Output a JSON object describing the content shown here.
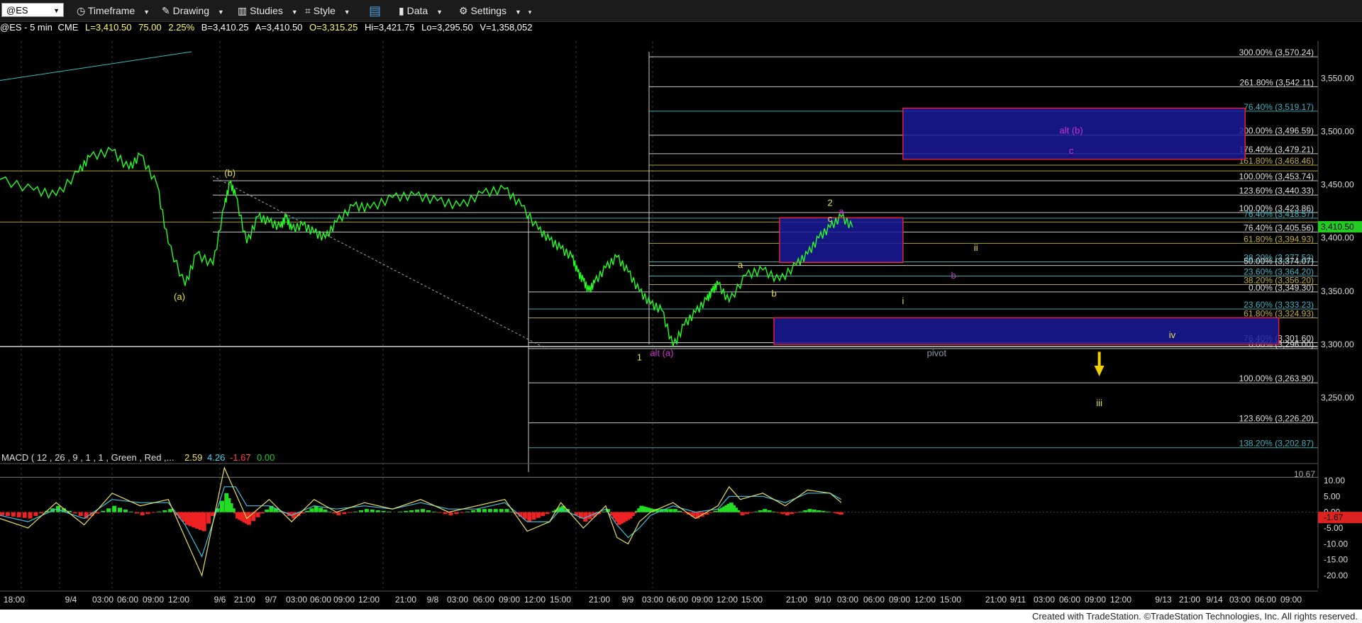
{
  "toolbar": {
    "symbol": "@ES",
    "timeframe": "Timeframe",
    "drawing": "Drawing",
    "studies": "Studies",
    "style": "Style",
    "data": "Data",
    "settings": "Settings"
  },
  "infobar": {
    "symbol": "@ES - 5 min",
    "exchange": "CME",
    "last": "L=3,410.50",
    "change": "75.00",
    "pct": "2.25%",
    "bid": "B=3,410.25",
    "ask": "A=3,410.50",
    "open": "O=3,315.25",
    "high": "Hi=3,421.75",
    "low": "Lo=3,295.50",
    "volume": "V=1,358,052"
  },
  "colors": {
    "price_line": "#22ff22",
    "wave_yellow": "#e8e04a",
    "wave_purple": "#cc33cc",
    "box_fill": "#1a1a9a",
    "box_border": "#e0203a",
    "macd_line": "#e8e060",
    "signal_line": "#40c0e0",
    "hist_up": "#22dd22",
    "hist_down": "#ee2222"
  },
  "chart_data": [
    {
      "type": "line",
      "title": "",
      "ylim": [
        3200,
        3585
      ],
      "y_ticks": [
        "3,550.00",
        "3,500.00",
        "3,450.00",
        "3,400.00",
        "3,350.00",
        "3,300.00",
        "3,250.00"
      ],
      "y_tick_values": [
        3550,
        3500,
        3450,
        3400,
        3350,
        3300,
        3250
      ],
      "x_ticks": [
        "18:00",
        "9/4",
        "03:00",
        "06:00",
        "09:00",
        "12:00",
        "9/6",
        "21:00",
        "9/7",
        "03:00",
        "06:00",
        "09:00",
        "12:00",
        "21:00",
        "9/8",
        "03:00",
        "06:00",
        "09:00",
        "12:00",
        "15:00",
        "21:00",
        "9/9",
        "03:00",
        "06:00",
        "09:00",
        "12:00",
        "15:00",
        "21:00",
        "9/10",
        "03:00",
        "06:00",
        "09:00",
        "12:00",
        "15:00",
        "21:00",
        "9/11",
        "03:00",
        "06:00",
        "09:00",
        "12:00",
        "9/13",
        "21:00",
        "9/14",
        "03:00",
        "06:00",
        "09:00"
      ],
      "current_price_label": "3,410.50",
      "series": [
        {
          "x": [
            0,
            6,
            10,
            14,
            16,
            20,
            23,
            25,
            28,
            30,
            33,
            35,
            38,
            40,
            41,
            42,
            44,
            46,
            48,
            50,
            51,
            52,
            54,
            56,
            58,
            60,
            63,
            66,
            70,
            74,
            78,
            82,
            86,
            90,
            93,
            96,
            98,
            100,
            102,
            103,
            104,
            105,
            106,
            108,
            110,
            112,
            114,
            116,
            118,
            120,
            122,
            124,
            126,
            127,
            128,
            130,
            133,
            136,
            139,
            142,
            144,
            146,
            148,
            150,
            152
          ],
          "values": [
            3455,
            3445,
            3440,
            3462,
            3476,
            3482,
            3465,
            3478,
            3450,
            3395,
            3355,
            3385,
            3375,
            3430,
            3452,
            3440,
            3395,
            3420,
            3415,
            3410,
            3420,
            3408,
            3412,
            3405,
            3400,
            3415,
            3430,
            3428,
            3438,
            3440,
            3435,
            3430,
            3442,
            3446,
            3430,
            3408,
            3398,
            3390,
            3382,
            3368,
            3360,
            3350,
            3358,
            3372,
            3382,
            3368,
            3350,
            3338,
            3332,
            3298,
            3318,
            3330,
            3342,
            3350,
            3357,
            3340,
            3365,
            3370,
            3360,
            3375,
            3385,
            3400,
            3410,
            3420,
            3410
          ]
        }
      ],
      "wave_labels": [
        {
          "text": "(b)",
          "color": "yellow",
          "x": 41,
          "y": 3458
        },
        {
          "text": "(a)",
          "color": "yellow",
          "x": 32,
          "y": 3342
        },
        {
          "text": "1",
          "color": "yellow",
          "x": 114,
          "y": 3285
        },
        {
          "text": "alt (a)",
          "color": "purple",
          "x": 118,
          "y": 3289
        },
        {
          "text": "a",
          "color": "yellow",
          "x": 132,
          "y": 3372
        },
        {
          "text": "b",
          "color": "yellow",
          "x": 138,
          "y": 3345
        },
        {
          "text": "2",
          "color": "yellow",
          "x": 148,
          "y": 3430
        },
        {
          "text": "c",
          "color": "yellow",
          "x": 148,
          "y": 3415
        },
        {
          "text": "a",
          "color": "purple",
          "x": 150,
          "y": 3422
        },
        {
          "text": "ii",
          "color": "yellow",
          "x": 174,
          "y": 3388
        },
        {
          "text": "b",
          "color": "purple",
          "x": 170,
          "y": 3362
        },
        {
          "text": "i",
          "color": "yellow",
          "x": 161,
          "y": 3338
        },
        {
          "text": "iv",
          "color": "yellow",
          "x": 209,
          "y": 3306
        },
        {
          "text": "alt (b)",
          "color": "purple",
          "x": 191,
          "y": 3498
        },
        {
          "text": "c",
          "color": "purple",
          "x": 191,
          "y": 3479
        },
        {
          "text": "pivot",
          "color": "gray",
          "x": 167,
          "y": 3289
        },
        {
          "text": "iii",
          "color": "yellow",
          "x": 196,
          "y": 3242
        }
      ],
      "fib_levels": [
        "300.00% (3,570.24)",
        "261.80% (3,542.11)",
        "76.40% (3,519.17)",
        "200.00% (3,496.59)",
        "176.40% (3,479.21)",
        "161.80% (3,468.46)",
        "100.00% (3,453.74)",
        "123.60% (3,440.33)",
        "100.00% (3,423.86)",
        "76.40% (3,418.57)",
        "76.40% (3,405.56)",
        "61.80% (3,394.93)",
        "38.20% (3,377.53)",
        "50.00% (3,374.07)",
        "23.60% (3,364.20)",
        "38.20% (3,356.20)",
        "0.00% (3,349.30)",
        "23.60% (3,333.23)",
        "61.80% (3,324.93)",
        "76.40% (3,301.60)",
        "0.00% (3,296.00)",
        "100.00% (3,263.90)",
        "123.60% (3,226.20)",
        "138.20% (3,202.87)"
      ],
      "fib_level_values": [
        3570.24,
        3542.11,
        3519.17,
        3496.59,
        3479.21,
        3468.46,
        3453.74,
        3440.33,
        3423.86,
        3418.57,
        3405.56,
        3394.93,
        3377.53,
        3374.07,
        3364.2,
        3356.2,
        3349.3,
        3333.23,
        3324.93,
        3301.6,
        3296.0,
        3263.9,
        3226.2,
        3202.87
      ],
      "fib_level_colors": [
        "white",
        "white",
        "teal",
        "white",
        "white",
        "olive",
        "white",
        "white",
        "white",
        "teal",
        "white",
        "olive",
        "teal",
        "white",
        "teal",
        "olive",
        "white",
        "teal",
        "olive",
        "white",
        "white",
        "white",
        "white",
        "teal"
      ],
      "target_boxes": [
        {
          "name": "alt (b)",
          "x0": 161,
          "x1": 222,
          "y0": 3474,
          "y1": 3522
        },
        {
          "name": "c wave box",
          "x0": 139,
          "x1": 161,
          "y0": 3377,
          "y1": 3419
        },
        {
          "name": "iv box",
          "x0": 138,
          "x1": 228,
          "y0": 3300,
          "y1": 3325
        }
      ]
    },
    {
      "type": "line",
      "title": "MACD ( 12 , 26 , 9 , 1 , 1 , Green , Red ,...",
      "values_legend": [
        "2.59",
        "4.26",
        "-1.67",
        "0.00"
      ],
      "ylim": [
        -24,
        14
      ],
      "y_ticks": [
        "10.00",
        "5.00",
        "0.00",
        "-5.00",
        "-10.00",
        "-15.00",
        "-20.00"
      ],
      "y_tick_values": [
        10,
        5,
        0,
        -5,
        -10,
        -15,
        -20
      ],
      "top_label": "10.67",
      "current_label": "-1.67",
      "series": [
        {
          "name": "MACD",
          "x": [
            0,
            5,
            10,
            15,
            20,
            25,
            30,
            33,
            36,
            40,
            42,
            44,
            48,
            52,
            56,
            60,
            65,
            70,
            75,
            80,
            85,
            90,
            94,
            98,
            100,
            104,
            108,
            110,
            112,
            114,
            116,
            120,
            124,
            128,
            130,
            132,
            136,
            140,
            144,
            148,
            150
          ],
          "values": [
            -2,
            -5,
            3,
            -4,
            6,
            2,
            4,
            -8,
            -20,
            14,
            6,
            -2,
            4,
            -3,
            4,
            0,
            3,
            1,
            4,
            0,
            2,
            4,
            -6,
            -3,
            3,
            -5,
            2,
            -8,
            -10,
            -3,
            0,
            3,
            -2,
            2,
            8,
            4,
            6,
            2,
            7,
            6,
            3
          ]
        },
        {
          "name": "Signal",
          "x": [
            0,
            5,
            10,
            15,
            20,
            25,
            30,
            33,
            36,
            40,
            42,
            44,
            48,
            52,
            56,
            60,
            65,
            70,
            75,
            80,
            85,
            90,
            94,
            98,
            100,
            104,
            108,
            110,
            112,
            114,
            116,
            120,
            124,
            128,
            130,
            132,
            136,
            140,
            144,
            148,
            150
          ],
          "values": [
            -1,
            -3,
            1,
            -2,
            4,
            3,
            3,
            -4,
            -14,
            8,
            8,
            2,
            2,
            -1,
            2,
            1,
            2,
            1,
            3,
            1,
            1,
            3,
            -3,
            -3,
            1,
            -2,
            1,
            -4,
            -8,
            -5,
            -1,
            2,
            0,
            1,
            5,
            5,
            5,
            3,
            6,
            6,
            4
          ]
        }
      ]
    }
  ],
  "footer": "Created with TradeStation. ©TradeStation Technologies, Inc. All rights reserved."
}
